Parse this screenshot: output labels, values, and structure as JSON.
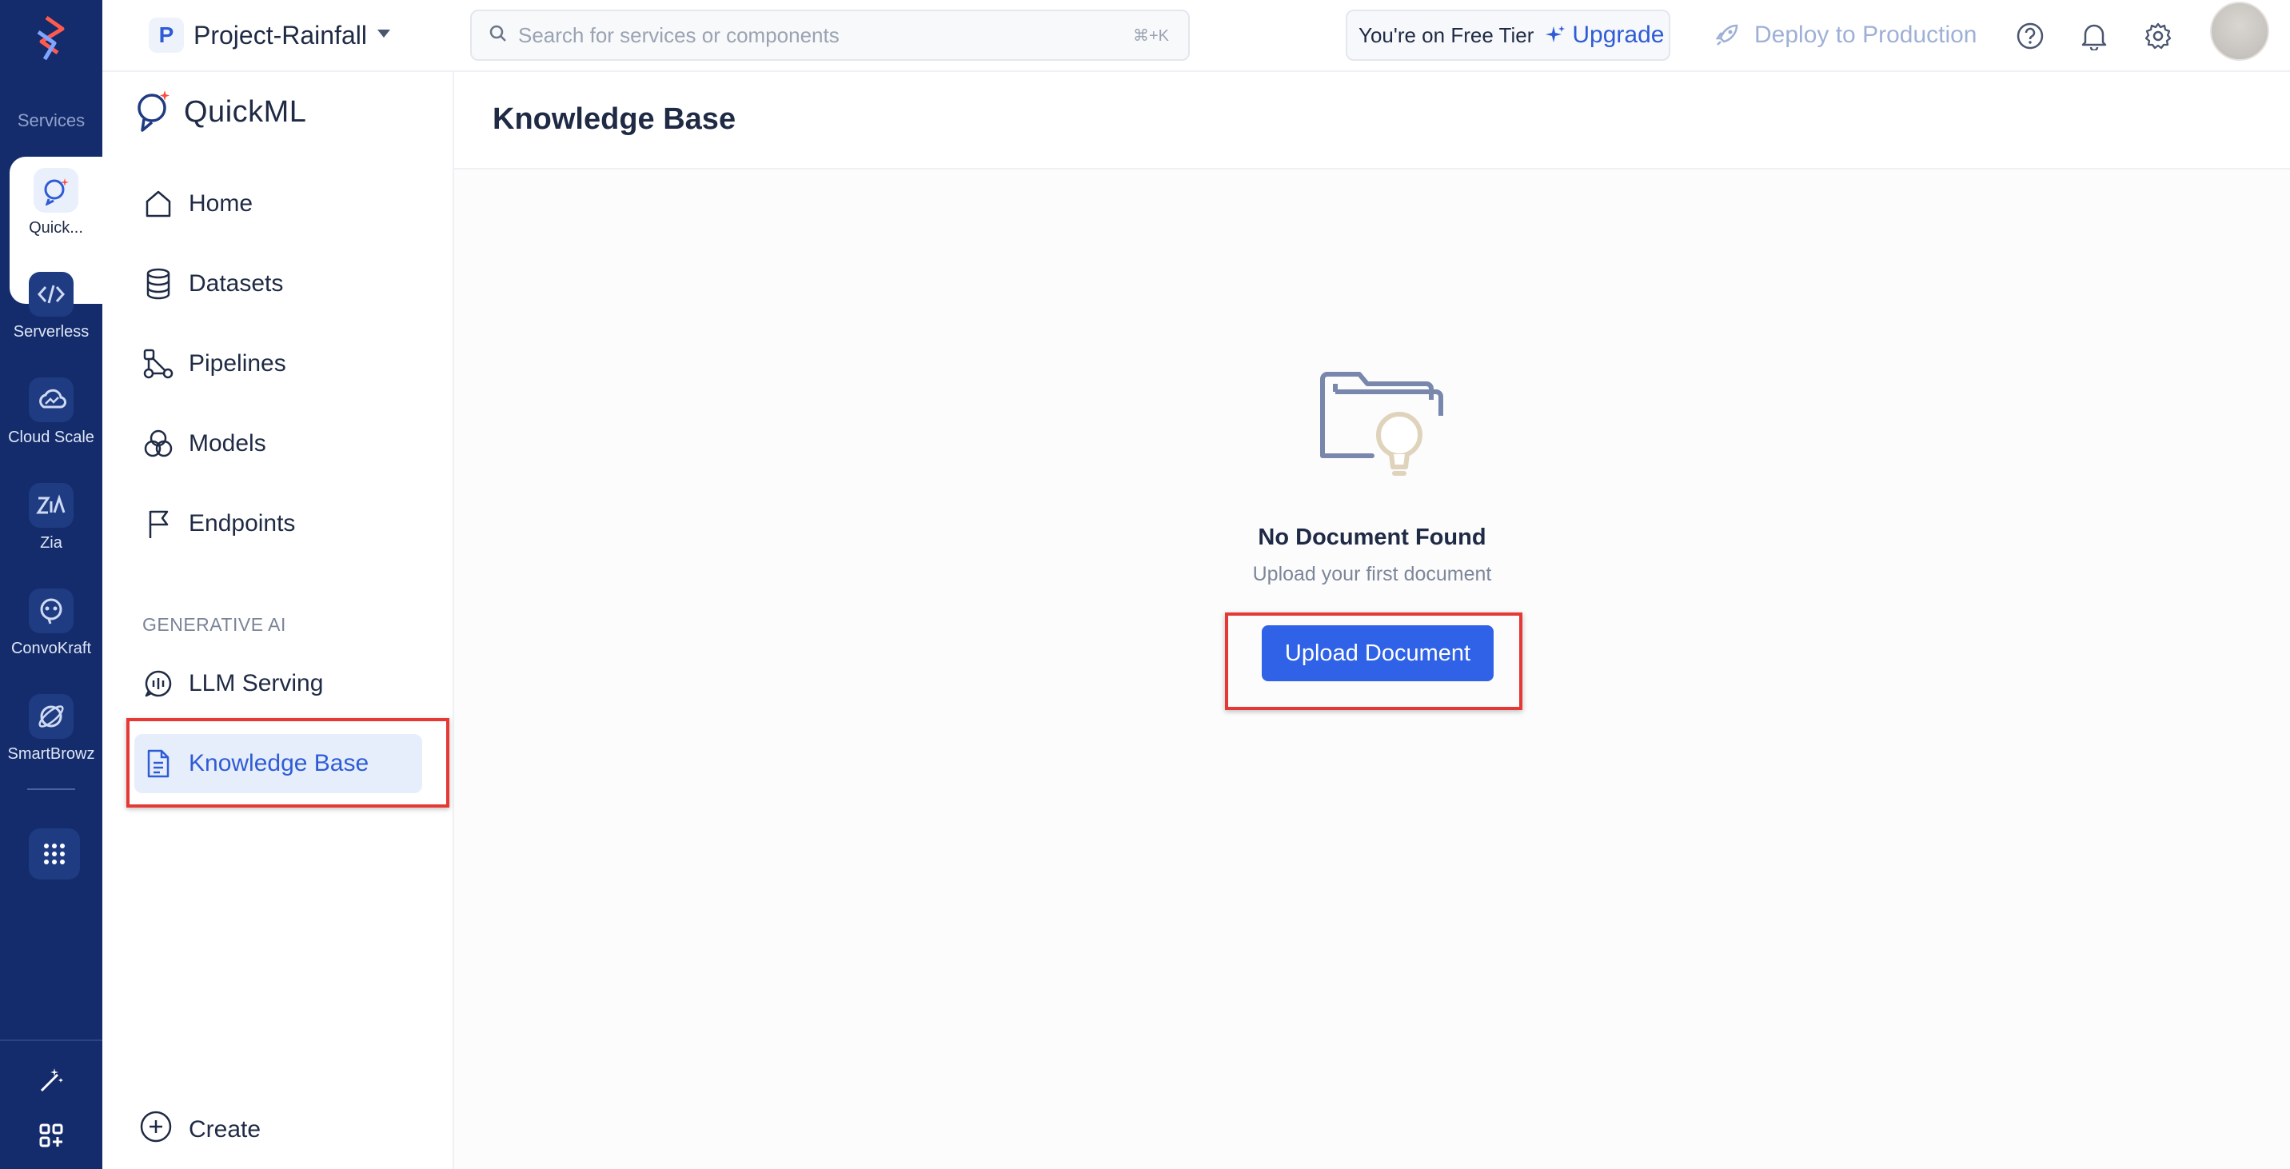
{
  "rail": {
    "section_label": "Services",
    "items": [
      {
        "label": "Quick...",
        "icon": "quickml-icon",
        "active": true
      },
      {
        "label": "Serverless",
        "icon": "serverless-icon"
      },
      {
        "label": "Cloud Scale",
        "icon": "cloud-scale-icon"
      },
      {
        "label": "Zia",
        "icon": "zia-icon"
      },
      {
        "label": "ConvoKraft",
        "icon": "convokraft-icon"
      },
      {
        "label": "SmartBrowz",
        "icon": "smartbrowz-icon"
      }
    ]
  },
  "topbar": {
    "project_initial": "P",
    "project_name": "Project-Rainfall",
    "search_placeholder": "Search for services or components",
    "search_shortcut": "⌘+K",
    "tier_text": "You're on Free Tier",
    "upgrade_label": "Upgrade",
    "deploy_label": "Deploy to Production"
  },
  "sidebar": {
    "brand": "QuickML",
    "items": [
      {
        "label": "Home"
      },
      {
        "label": "Datasets"
      },
      {
        "label": "Pipelines"
      },
      {
        "label": "Models"
      },
      {
        "label": "Endpoints"
      }
    ],
    "gen_ai_heading": "GENERATIVE AI",
    "gen_ai_items": [
      {
        "label": "LLM Serving"
      },
      {
        "label": "Knowledge Base",
        "active": true
      }
    ],
    "create_label": "Create"
  },
  "main": {
    "title": "Knowledge Base",
    "empty_title": "No Document Found",
    "empty_subtitle": "Upload your first document",
    "upload_label": "Upload Document"
  },
  "colors": {
    "rail_bg": "#142c6b",
    "accent": "#2f62e6",
    "active_bg": "#e7eefb",
    "highlight": "#e53935"
  }
}
